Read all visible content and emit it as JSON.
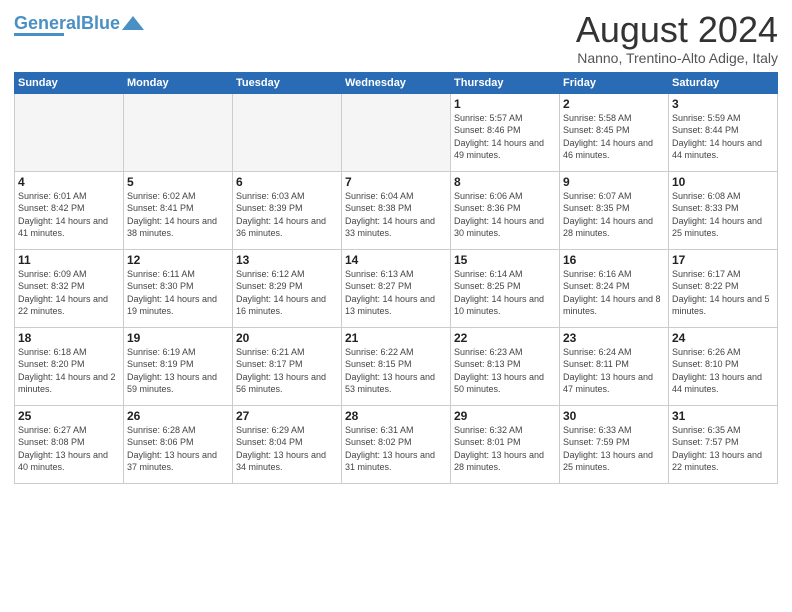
{
  "header": {
    "logo_general": "General",
    "logo_blue": "Blue",
    "month_title": "August 2024",
    "subtitle": "Nanno, Trentino-Alto Adige, Italy"
  },
  "days_of_week": [
    "Sunday",
    "Monday",
    "Tuesday",
    "Wednesday",
    "Thursday",
    "Friday",
    "Saturday"
  ],
  "weeks": [
    [
      {
        "day": "",
        "info": "",
        "empty": true
      },
      {
        "day": "",
        "info": "",
        "empty": true
      },
      {
        "day": "",
        "info": "",
        "empty": true
      },
      {
        "day": "",
        "info": "",
        "empty": true
      },
      {
        "day": "1",
        "info": "Sunrise: 5:57 AM\nSunset: 8:46 PM\nDaylight: 14 hours and 49 minutes."
      },
      {
        "day": "2",
        "info": "Sunrise: 5:58 AM\nSunset: 8:45 PM\nDaylight: 14 hours and 46 minutes."
      },
      {
        "day": "3",
        "info": "Sunrise: 5:59 AM\nSunset: 8:44 PM\nDaylight: 14 hours and 44 minutes."
      }
    ],
    [
      {
        "day": "4",
        "info": "Sunrise: 6:01 AM\nSunset: 8:42 PM\nDaylight: 14 hours and 41 minutes."
      },
      {
        "day": "5",
        "info": "Sunrise: 6:02 AM\nSunset: 8:41 PM\nDaylight: 14 hours and 38 minutes."
      },
      {
        "day": "6",
        "info": "Sunrise: 6:03 AM\nSunset: 8:39 PM\nDaylight: 14 hours and 36 minutes."
      },
      {
        "day": "7",
        "info": "Sunrise: 6:04 AM\nSunset: 8:38 PM\nDaylight: 14 hours and 33 minutes."
      },
      {
        "day": "8",
        "info": "Sunrise: 6:06 AM\nSunset: 8:36 PM\nDaylight: 14 hours and 30 minutes."
      },
      {
        "day": "9",
        "info": "Sunrise: 6:07 AM\nSunset: 8:35 PM\nDaylight: 14 hours and 28 minutes."
      },
      {
        "day": "10",
        "info": "Sunrise: 6:08 AM\nSunset: 8:33 PM\nDaylight: 14 hours and 25 minutes."
      }
    ],
    [
      {
        "day": "11",
        "info": "Sunrise: 6:09 AM\nSunset: 8:32 PM\nDaylight: 14 hours and 22 minutes."
      },
      {
        "day": "12",
        "info": "Sunrise: 6:11 AM\nSunset: 8:30 PM\nDaylight: 14 hours and 19 minutes."
      },
      {
        "day": "13",
        "info": "Sunrise: 6:12 AM\nSunset: 8:29 PM\nDaylight: 14 hours and 16 minutes."
      },
      {
        "day": "14",
        "info": "Sunrise: 6:13 AM\nSunset: 8:27 PM\nDaylight: 14 hours and 13 minutes."
      },
      {
        "day": "15",
        "info": "Sunrise: 6:14 AM\nSunset: 8:25 PM\nDaylight: 14 hours and 10 minutes."
      },
      {
        "day": "16",
        "info": "Sunrise: 6:16 AM\nSunset: 8:24 PM\nDaylight: 14 hours and 8 minutes."
      },
      {
        "day": "17",
        "info": "Sunrise: 6:17 AM\nSunset: 8:22 PM\nDaylight: 14 hours and 5 minutes."
      }
    ],
    [
      {
        "day": "18",
        "info": "Sunrise: 6:18 AM\nSunset: 8:20 PM\nDaylight: 14 hours and 2 minutes."
      },
      {
        "day": "19",
        "info": "Sunrise: 6:19 AM\nSunset: 8:19 PM\nDaylight: 13 hours and 59 minutes."
      },
      {
        "day": "20",
        "info": "Sunrise: 6:21 AM\nSunset: 8:17 PM\nDaylight: 13 hours and 56 minutes."
      },
      {
        "day": "21",
        "info": "Sunrise: 6:22 AM\nSunset: 8:15 PM\nDaylight: 13 hours and 53 minutes."
      },
      {
        "day": "22",
        "info": "Sunrise: 6:23 AM\nSunset: 8:13 PM\nDaylight: 13 hours and 50 minutes."
      },
      {
        "day": "23",
        "info": "Sunrise: 6:24 AM\nSunset: 8:11 PM\nDaylight: 13 hours and 47 minutes."
      },
      {
        "day": "24",
        "info": "Sunrise: 6:26 AM\nSunset: 8:10 PM\nDaylight: 13 hours and 44 minutes."
      }
    ],
    [
      {
        "day": "25",
        "info": "Sunrise: 6:27 AM\nSunset: 8:08 PM\nDaylight: 13 hours and 40 minutes."
      },
      {
        "day": "26",
        "info": "Sunrise: 6:28 AM\nSunset: 8:06 PM\nDaylight: 13 hours and 37 minutes."
      },
      {
        "day": "27",
        "info": "Sunrise: 6:29 AM\nSunset: 8:04 PM\nDaylight: 13 hours and 34 minutes."
      },
      {
        "day": "28",
        "info": "Sunrise: 6:31 AM\nSunset: 8:02 PM\nDaylight: 13 hours and 31 minutes."
      },
      {
        "day": "29",
        "info": "Sunrise: 6:32 AM\nSunset: 8:01 PM\nDaylight: 13 hours and 28 minutes."
      },
      {
        "day": "30",
        "info": "Sunrise: 6:33 AM\nSunset: 7:59 PM\nDaylight: 13 hours and 25 minutes."
      },
      {
        "day": "31",
        "info": "Sunrise: 6:35 AM\nSunset: 7:57 PM\nDaylight: 13 hours and 22 minutes."
      }
    ]
  ]
}
